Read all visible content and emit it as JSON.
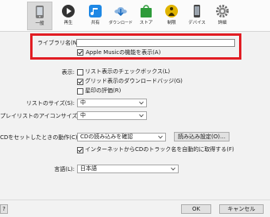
{
  "toolbar": {
    "tabs": [
      {
        "label": "一般",
        "icon": "general-device-icon",
        "selected": true
      },
      {
        "label": "再生",
        "icon": "playback-icon"
      },
      {
        "label": "共有",
        "icon": "sharing-icon"
      },
      {
        "label": "ダウンロード",
        "icon": "download-icon"
      },
      {
        "label": "ストア",
        "icon": "store-icon"
      },
      {
        "label": "制限",
        "icon": "restrictions-icon"
      },
      {
        "label": "デバイス",
        "icon": "devices-icon"
      },
      {
        "label": "詳細",
        "icon": "advanced-gear-icon"
      }
    ]
  },
  "library": {
    "name_label": "ライブラリ名(N):",
    "name_value": "",
    "apple_music_label": "Apple Musicの機能を表示(A)",
    "apple_music_checked": true
  },
  "display": {
    "label": "表示:",
    "options": [
      {
        "label": "リスト表示のチェックボックス(L)",
        "checked": false
      },
      {
        "label": "グリッド表示のダウンロードバッジ(G)",
        "checked": true
      },
      {
        "label": "星印の評価(R)",
        "checked": false
      }
    ]
  },
  "list_size": {
    "label": "リストのサイズ(S):",
    "value": "中"
  },
  "playlist_icon_size": {
    "label": "プレイリストのアイコンサイズ(P):",
    "value": "中"
  },
  "cd": {
    "label": "CDをセットしたときの動作(C):",
    "value": "CDの読み込みを確認",
    "import_settings_button": "読み込み設定(O)…",
    "auto_fetch_label": "インターネットからCDのトラック名を自動的に取得する(F)",
    "auto_fetch_checked": true
  },
  "language": {
    "label": "言語(L):",
    "value": "日本語"
  },
  "footer": {
    "help": "?",
    "ok": "OK",
    "cancel": "キャンセル"
  },
  "colors": {
    "highlight": "#e11d23",
    "itunes_blue": "#1e88e5",
    "store_green": "#2e9b3a",
    "restrictions_yellow": "#e0b400"
  }
}
